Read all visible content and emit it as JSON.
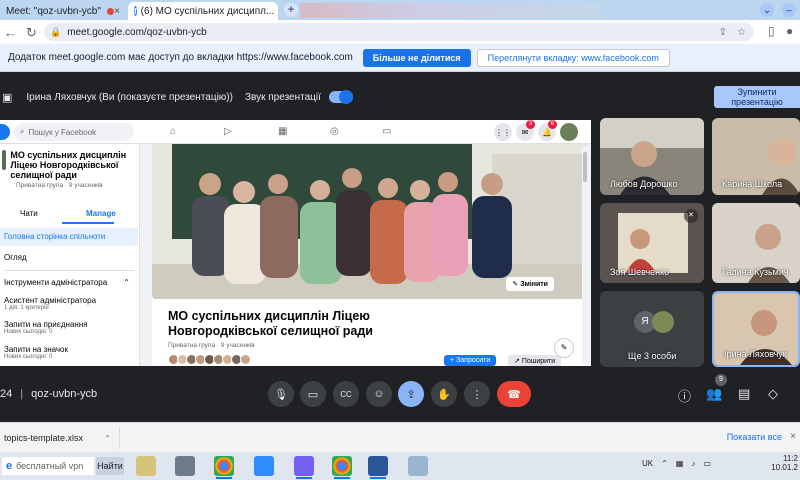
{
  "browser": {
    "tabs": [
      {
        "title": "Meet: \"qoz-uvbn-ycb\""
      },
      {
        "title": "(6) МО суспільних дисципл..."
      }
    ],
    "new_tab_label": "+",
    "url": "meet.google.com/qoz-uvbn-ycb"
  },
  "share_notice": {
    "text": "Додаток meet.google.com має доступ до вкладки https://www.facebook.com",
    "stop_button": "Більше не ділитися",
    "view_button": "Переглянути вкладку: www.facebook.com"
  },
  "presenting_bar": {
    "presenter": "Ірина Ляховчук (Ви (показуєте презентацію))",
    "audio_label": "Звук презентації",
    "stop_button_line1": "Зупинити",
    "stop_button_line2": "презентацію"
  },
  "facebook": {
    "search_placeholder": "Пошук у Facebook",
    "group_name": "МО суспільних дисциплін Ліцею Новгородківської селищної ради",
    "group_meta": "Приватна група · 9 учасників",
    "side_tabs": {
      "chats": "Чати",
      "manage": "Manage"
    },
    "side_items": {
      "home": "Головна сторінка спільноти",
      "overview": "Огляд",
      "admin_tools": "Інструменти адміністратора",
      "admin_assistant": "Асистент адміністратора",
      "admin_assistant_sub": "1 дія, 1 критерій",
      "join_requests": "Запити на приєднання",
      "join_requests_sub": "Нових сьогодні: 0",
      "badge_requests": "Запити на значок",
      "badge_requests_sub": "Нових сьогодні: 0"
    },
    "edit_cover": "Змінити",
    "title_line1": "МО суспільних дисциплін Ліцею",
    "title_line2": "Новгородківської селищної ради",
    "title_meta": "Приватна група · 9 учасників",
    "invite_button": "+ Запросити",
    "share_button": "Поширити",
    "notif_badges": {
      "messenger": "3",
      "bell": "6"
    }
  },
  "participants": [
    {
      "name": "Любов Дорошко",
      "muted": false
    },
    {
      "name": "Карина Школа",
      "muted": false
    },
    {
      "name": "Зоя Шевченко",
      "muted": true
    },
    {
      "name": "Галина Кузьмич",
      "muted": false
    },
    {
      "name": "Ще 3 особи",
      "initial": "Я"
    },
    {
      "name": "Ірина Ляховчук",
      "muted": false
    }
  ],
  "controls": {
    "time": "24",
    "meeting_code": "qoz-uvbn-ycb",
    "participant_count": "9",
    "icons": [
      "mic-icon",
      "camera-icon",
      "captions-icon",
      "emoji-icon",
      "present-icon",
      "raise-hand-icon",
      "more-icon",
      "end-call-icon"
    ],
    "right_icons": [
      "info-icon",
      "people-icon",
      "chat-icon",
      "activities-icon"
    ]
  },
  "download": {
    "file": "topics-template.xlsx",
    "show_all": "Показати все"
  },
  "taskbar": {
    "search_text": "бесплатный vpn",
    "go_button": "Найти",
    "lang": "UK",
    "time": "11:2",
    "date": "10.01.2"
  },
  "colors": {
    "meet_bg": "#202124",
    "accent": "#8ab4f8",
    "end_call": "#ea4335",
    "facebook_blue": "#1877f2"
  }
}
